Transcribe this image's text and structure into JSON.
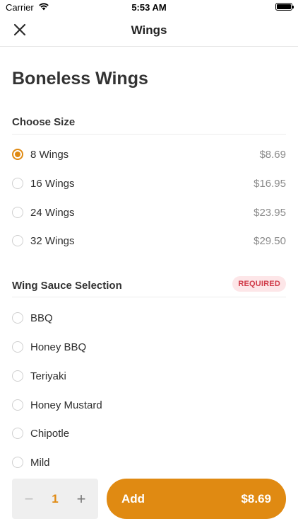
{
  "status_bar": {
    "carrier": "Carrier",
    "time": "5:53 AM"
  },
  "nav": {
    "title": "Wings"
  },
  "item": {
    "title": "Boneless Wings"
  },
  "size_section": {
    "title": "Choose Size",
    "options": [
      {
        "label": "8 Wings",
        "price": "$8.69",
        "selected": true
      },
      {
        "label": "16 Wings",
        "price": "$16.95",
        "selected": false
      },
      {
        "label": "24 Wings",
        "price": "$23.95",
        "selected": false
      },
      {
        "label": "32 Wings",
        "price": "$29.50",
        "selected": false
      }
    ]
  },
  "sauce_section": {
    "title": "Wing Sauce Selection",
    "badge": "REQUIRED",
    "options": [
      {
        "label": "BBQ",
        "selected": false
      },
      {
        "label": "Honey BBQ",
        "selected": false
      },
      {
        "label": "Teriyaki",
        "selected": false
      },
      {
        "label": "Honey Mustard",
        "selected": false
      },
      {
        "label": "Chipotle",
        "selected": false
      },
      {
        "label": "Mild",
        "selected": false
      }
    ]
  },
  "footer": {
    "minus": "−",
    "quantity": "1",
    "plus": "+",
    "add_label": "Add",
    "add_price": "$8.69"
  },
  "colors": {
    "accent": "#e08a12",
    "badge_bg": "#fde6e8",
    "badge_text": "#d03a48"
  }
}
